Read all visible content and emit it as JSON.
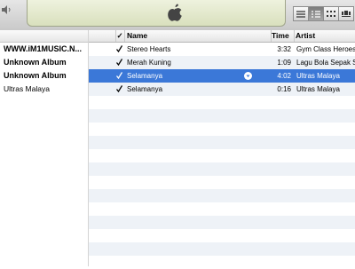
{
  "window": {
    "display_icon": "apple-logo-icon"
  },
  "view_buttons": [
    {
      "name": "list-view-button",
      "active": false
    },
    {
      "name": "album-list-view-button",
      "active": true
    },
    {
      "name": "grid-view-button",
      "active": false
    },
    {
      "name": "cover-flow-view-button",
      "active": false
    }
  ],
  "left_pane": {
    "items": [
      {
        "label": "WWW.iM1MUSIC.N...",
        "bold": true
      },
      {
        "label": "Unknown Album",
        "bold": true
      },
      {
        "label": "Unknown Album",
        "bold": true
      },
      {
        "label": "Ultras Malaya",
        "bold": false
      }
    ]
  },
  "table": {
    "headers": {
      "check": "✓",
      "name": "Name",
      "time": "Time",
      "artist": "Artist"
    },
    "rows": [
      {
        "checked": true,
        "name": "Stereo Hearts",
        "time": "3:32",
        "artist": "Gym Class Heroes Feat.",
        "selected": false
      },
      {
        "checked": true,
        "name": "Merah Kuning",
        "time": "1:09",
        "artist": "Lagu Bola Sepak Sem",
        "selected": false
      },
      {
        "checked": true,
        "name": "Selamanya",
        "time": "4:02",
        "artist": "Ultras Malaya",
        "selected": true
      },
      {
        "checked": true,
        "name": "Selamanya",
        "time": "0:16",
        "artist": "Ultras Malaya",
        "selected": false
      }
    ]
  }
}
